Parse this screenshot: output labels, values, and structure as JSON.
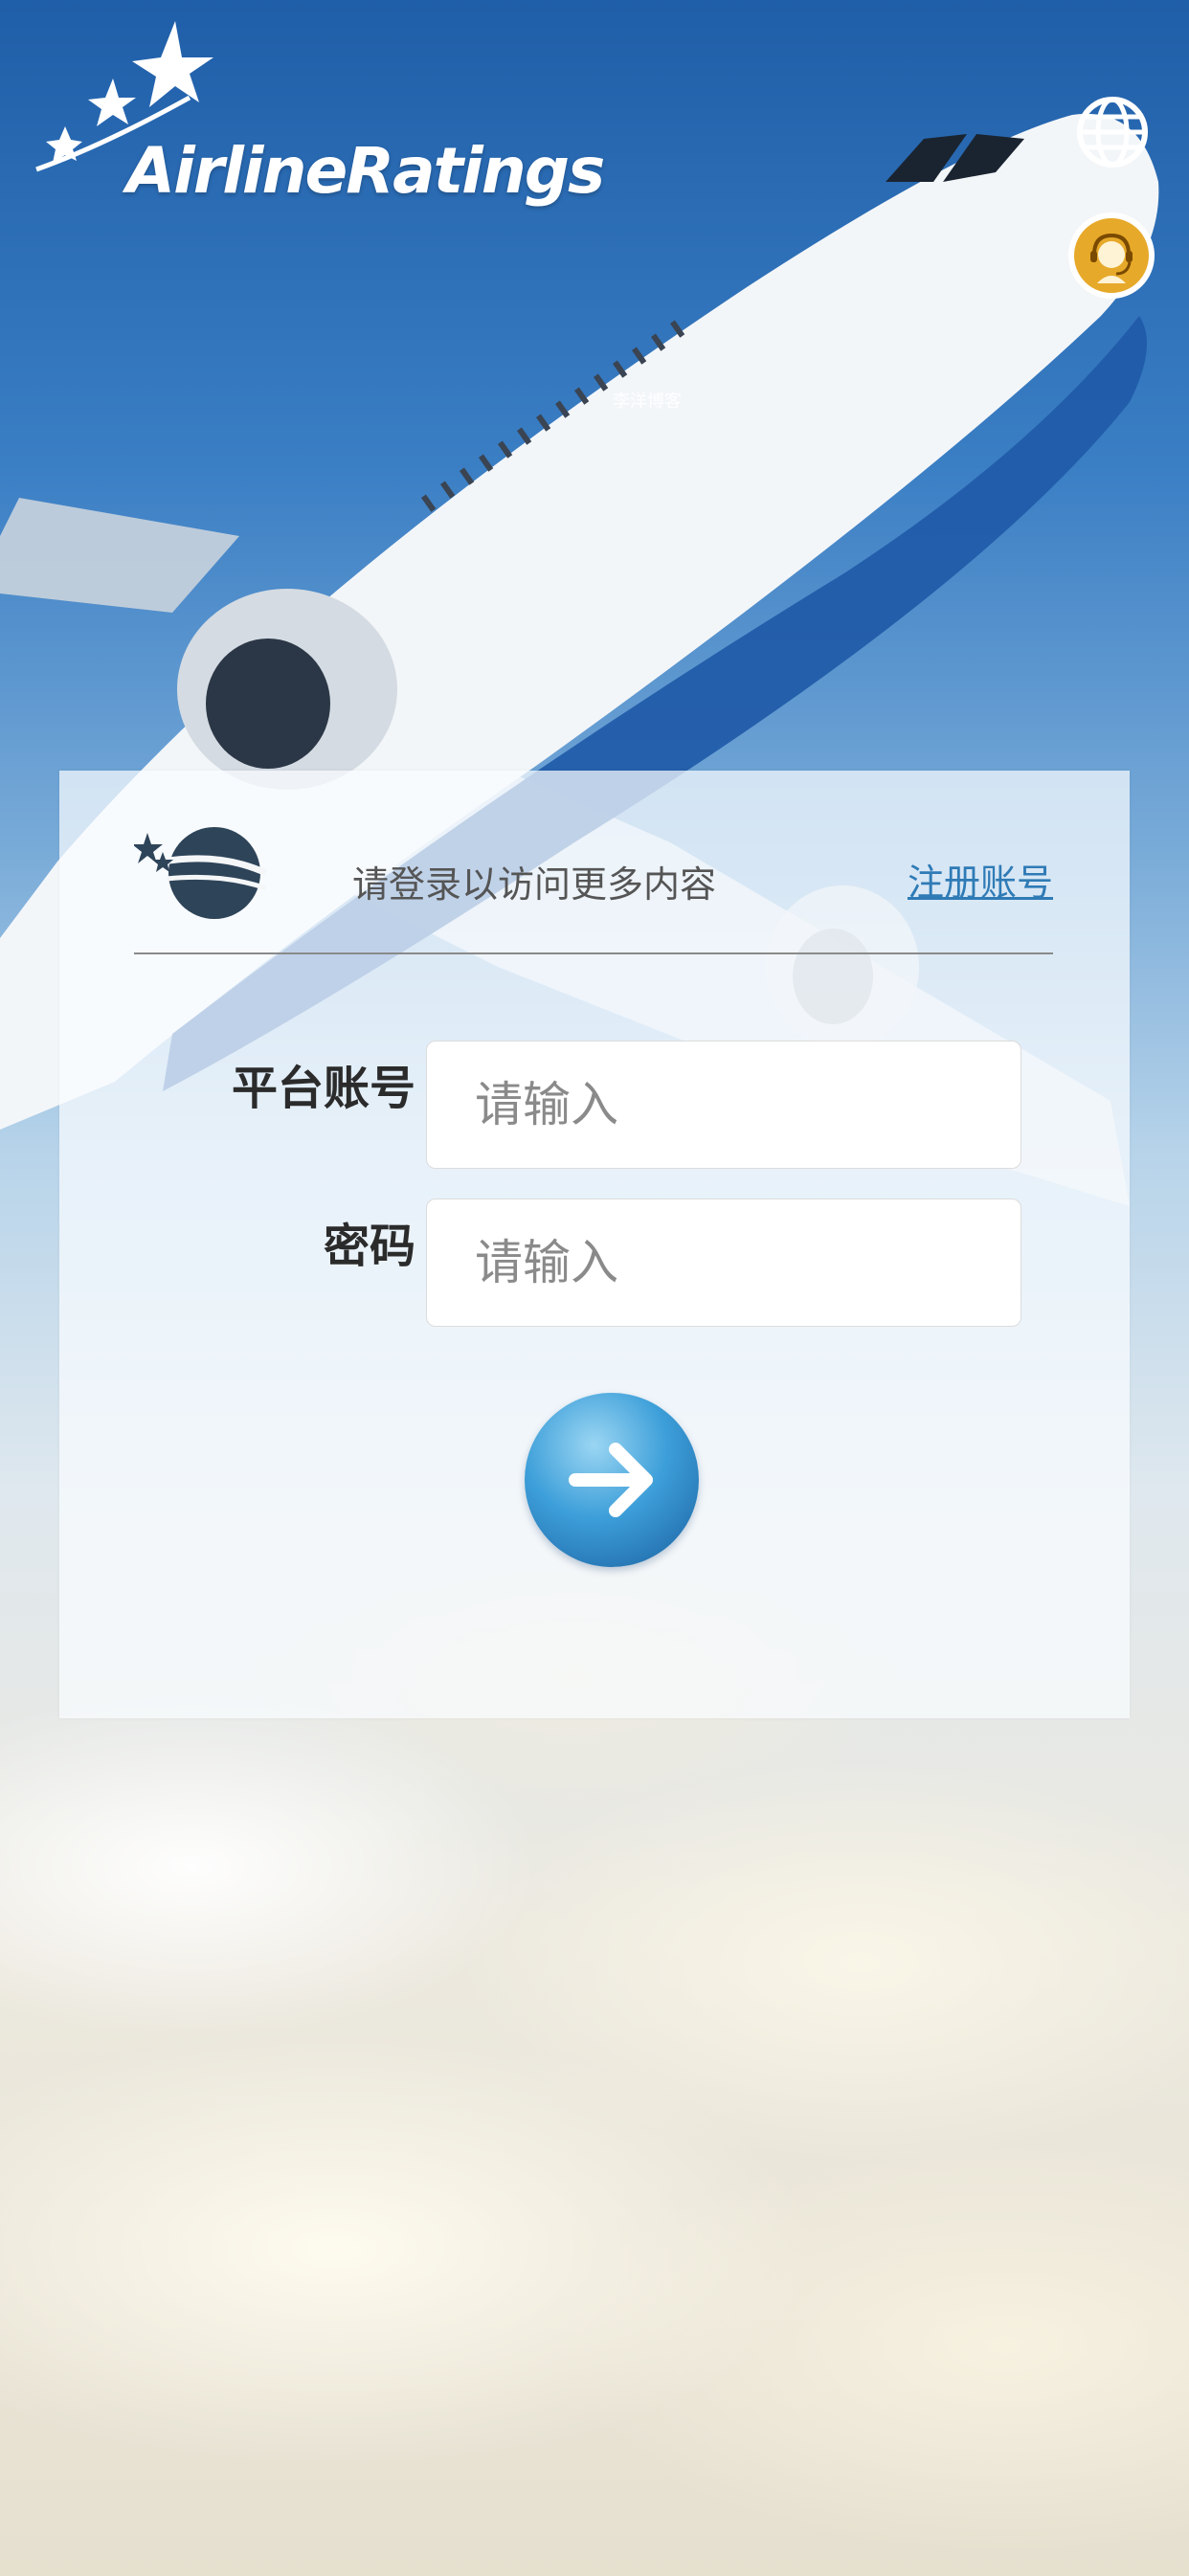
{
  "brand": {
    "logo_text": "AirlineRatings"
  },
  "header_icons": {
    "language": "globe-icon",
    "support": "customer-service-icon"
  },
  "watermark": "李洋博客",
  "login_card": {
    "prompt": "请登录以访问更多内容",
    "register_link": "注册账号",
    "account_label": "平台账号",
    "account_placeholder": "请输入",
    "password_label": "密码",
    "password_placeholder": "请输入",
    "submit_icon": "arrow-right-icon"
  },
  "colors": {
    "link": "#2f7bb6",
    "support_bg": "#e7a92a",
    "button_blue": "#3d9fd9"
  }
}
